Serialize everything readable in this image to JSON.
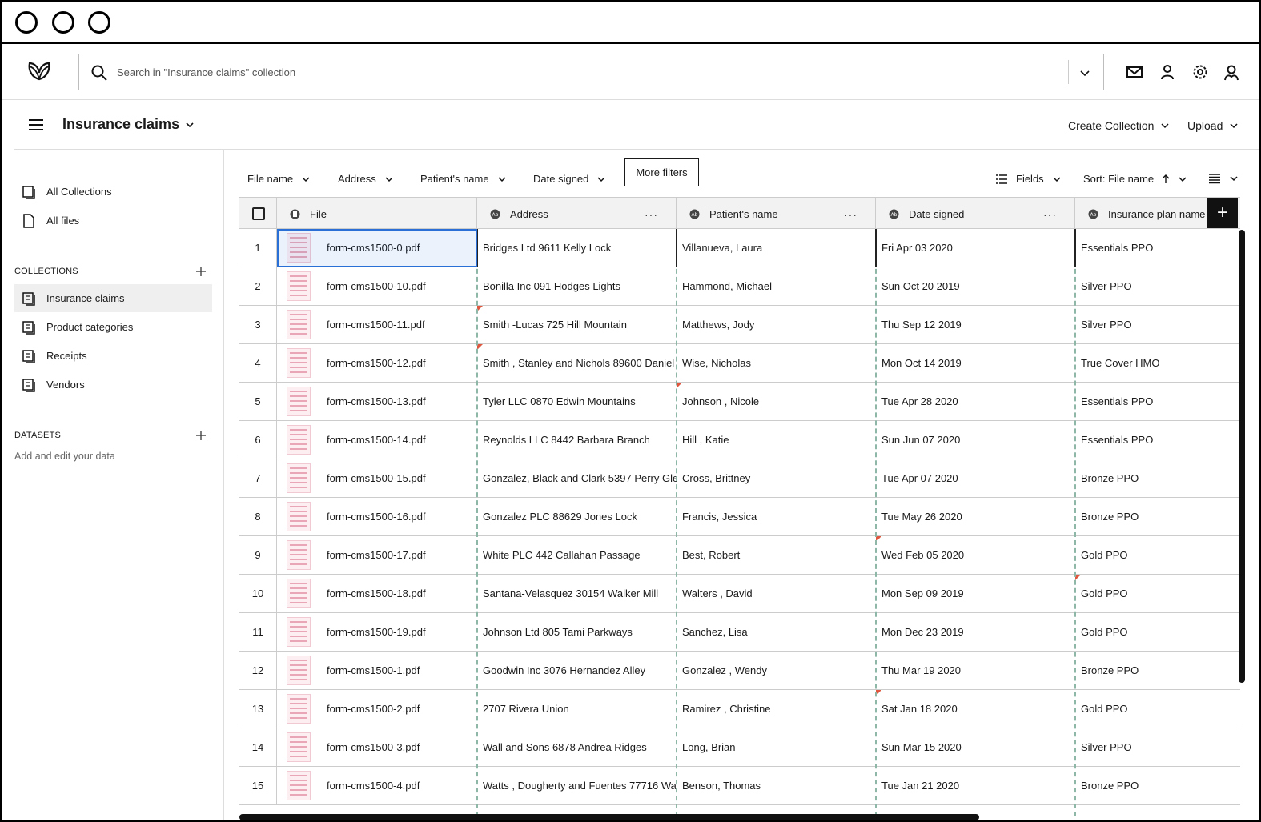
{
  "header": {
    "search_placeholder": "Search in \"Insurance claims\" collection",
    "icons": [
      "mail-icon",
      "user-icon",
      "gear-icon",
      "account-icon"
    ]
  },
  "titlebar": {
    "title": "Insurance claims",
    "create_collection": "Create Collection",
    "upload": "Upload"
  },
  "sidebar": {
    "all_collections": "All Collections",
    "all_files": "All files",
    "collections_heading": "COLLECTIONS",
    "collections": [
      "Insurance claims",
      "Product categories",
      "Receipts",
      "Vendors"
    ],
    "datasets_heading": "DATASETS",
    "datasets_hint": "Add and edit your data"
  },
  "filters": {
    "file_name": "File name",
    "address": "Address",
    "patient_name": "Patient's name",
    "date_signed": "Date signed",
    "more_filters": "More filters",
    "fields": "Fields",
    "sort": "Sort: File name"
  },
  "table": {
    "columns": [
      "File",
      "Address",
      "Patient's name",
      "Date signed",
      "Insurance plan name"
    ],
    "rows": [
      {
        "n": "1",
        "file": "form-cms1500-0.pdf",
        "address": "Bridges Ltd 9611 Kelly Lock",
        "patient": "Villanueva, Laura",
        "date": "Fri Apr 03 2020",
        "plan": "Essentials PPO"
      },
      {
        "n": "2",
        "file": "form-cms1500-10.pdf",
        "address": "Bonilla Inc 091 Hodges Lights",
        "patient": "Hammond, Michael",
        "date": "Sun Oct 20 2019",
        "plan": "Silver PPO"
      },
      {
        "n": "3",
        "file": "form-cms1500-11.pdf",
        "address": "Smith -Lucas 725 Hill Mountain",
        "patient": "Matthews, Jody",
        "date": "Thu Sep 12 2019",
        "plan": "Silver PPO"
      },
      {
        "n": "4",
        "file": "form-cms1500-12.pdf",
        "address": "Smith , Stanley and Nichols 89600 Daniel",
        "patient": "Wise, Nicholas",
        "date": "Mon Oct 14 2019",
        "plan": "True Cover HMO"
      },
      {
        "n": "5",
        "file": "form-cms1500-13.pdf",
        "address": "Tyler LLC 0870 Edwin Mountains",
        "patient": "Johnson , Nicole",
        "date": "Tue Apr 28 2020",
        "plan": "Essentials PPO"
      },
      {
        "n": "6",
        "file": "form-cms1500-14.pdf",
        "address": "Reynolds LLC 8442 Barbara Branch",
        "patient": "Hill , Katie",
        "date": "Sun Jun 07 2020",
        "plan": "Essentials PPO"
      },
      {
        "n": "7",
        "file": "form-cms1500-15.pdf",
        "address": "Gonzalez, Black and Clark 5397 Perry Gle",
        "patient": "Cross, Brittney",
        "date": "Tue Apr 07 2020",
        "plan": "Bronze PPO"
      },
      {
        "n": "8",
        "file": "form-cms1500-16.pdf",
        "address": "Gonzalez PLC 88629 Jones Lock",
        "patient": "Francis, Jessica",
        "date": "Tue May 26 2020",
        "plan": "Bronze PPO"
      },
      {
        "n": "9",
        "file": "form-cms1500-17.pdf",
        "address": "White PLC 442 Callahan Passage",
        "patient": "Best, Robert",
        "date": "Wed Feb 05 2020",
        "plan": "Gold PPO"
      },
      {
        "n": "10",
        "file": "form-cms1500-18.pdf",
        "address": "Santana-Velasquez 30154 Walker Mill",
        "patient": "Walters , David",
        "date": "Mon Sep 09 2019",
        "plan": "Gold PPO"
      },
      {
        "n": "11",
        "file": "form-cms1500-19.pdf",
        "address": "Johnson Ltd 805 Tami Parkways",
        "patient": "Sanchez, Lisa",
        "date": "Mon Dec 23 2019",
        "plan": "Gold PPO"
      },
      {
        "n": "12",
        "file": "form-cms1500-1.pdf",
        "address": "Goodwin Inc 3076 Hernandez Alley",
        "patient": "Gonzalez , Wendy",
        "date": "Thu Mar 19 2020",
        "plan": "Bronze PPO"
      },
      {
        "n": "13",
        "file": "form-cms1500-2.pdf",
        "address": "2707 Rivera Union",
        "patient": "Ramirez , Christine",
        "date": "Sat Jan 18 2020",
        "plan": "Gold PPO"
      },
      {
        "n": "14",
        "file": "form-cms1500-3.pdf",
        "address": "Wall and Sons 6878 Andrea Ridges",
        "patient": "Long, Brian",
        "date": "Sun Mar 15 2020",
        "plan": "Silver PPO"
      },
      {
        "n": "15",
        "file": "form-cms1500-4.pdf",
        "address": "Watts , Dougherty and Fuentes 77716 Wa",
        "patient": "Benson, Thomas",
        "date": "Tue Jan 21 2020",
        "plan": "Bronze PPO"
      }
    ]
  }
}
